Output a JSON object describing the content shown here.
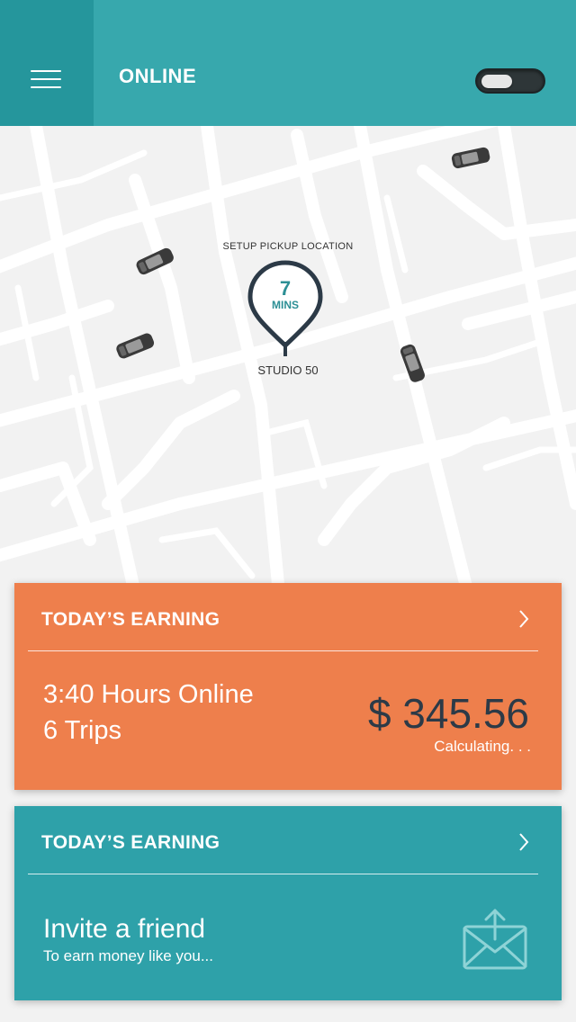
{
  "header": {
    "title": "ONLINE",
    "menu_icon": "hamburger-icon",
    "toggle_state": "off"
  },
  "map": {
    "pickup_label": "SETUP PICKUP LOCATION",
    "eta_value": "7",
    "eta_unit": "MINS",
    "place_name": "STUDIO 50"
  },
  "earning_card": {
    "title": "TODAY’S EARNING",
    "hours_online": "3:40 Hours Online",
    "trips": "6 Trips",
    "amount": "$ 345.56",
    "status": "Calculating. . ."
  },
  "invite_card": {
    "title": "TODAY’S EARNING",
    "invite_title": "Invite a friend",
    "invite_subtitle": "To earn money like you..."
  },
  "colors": {
    "teal": "#2ea1a9",
    "teal_dark": "#25969c",
    "orange": "#ee7f4c",
    "amount_text": "#2c3a47"
  }
}
